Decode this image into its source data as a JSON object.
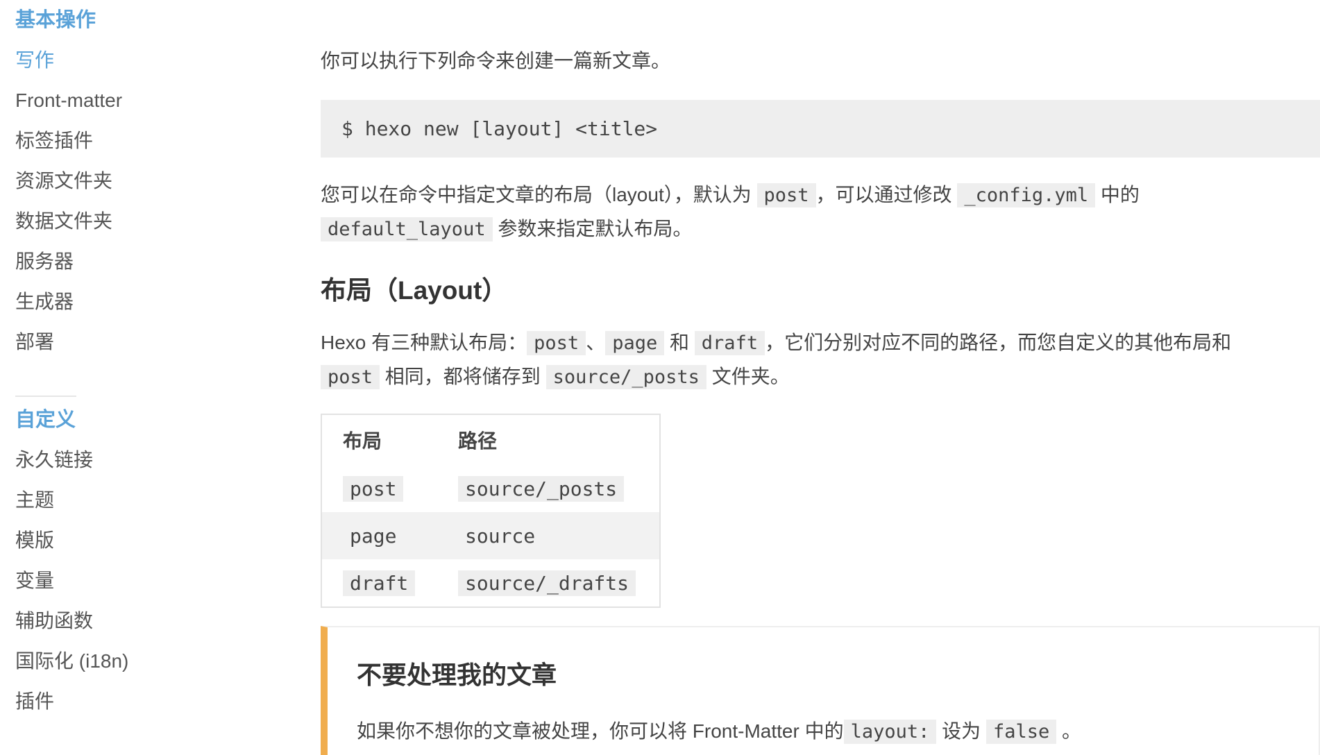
{
  "sidebar": {
    "group1_title": "基本操作",
    "group1_items": [
      "写作",
      "Front-matter",
      "标签插件",
      "资源文件夹",
      "数据文件夹",
      "服务器",
      "生成器",
      "部署"
    ],
    "group2_title": "自定义",
    "group2_items": [
      "永久链接",
      "主题",
      "模版",
      "变量",
      "辅助函数",
      "国际化 (i18n)",
      "插件"
    ]
  },
  "main": {
    "intro": "你可以执行下列命令来创建一篇新文章。",
    "command": "$ hexo new [layout] <title>",
    "layout_para": {
      "t1": "您可以在命令中指定文章的布局（layout），默认为 ",
      "c1": "post",
      "t2": "，可以通过修改 ",
      "c2": "_config.yml",
      "t3": " 中的 ",
      "c3": "default_layout",
      "t4": " 参数来指定默认布局。"
    },
    "heading": "布局（Layout）",
    "hexo_para": {
      "t1": "Hexo 有三种默认布局：",
      "c1": "post",
      "t2": "、",
      "c2": "page",
      "t3": " 和 ",
      "c3": "draft",
      "t4": "，它们分别对应不同的路径，而您自定义的其他布局和 ",
      "c4": "post",
      "t5": " 相同，都将储存到 ",
      "c5": "source/_posts",
      "t6": " 文件夹。"
    },
    "table": {
      "headers": [
        "布局",
        "路径"
      ],
      "rows": [
        [
          "post",
          "source/_posts"
        ],
        [
          "page",
          "source"
        ],
        [
          "draft",
          "source/_drafts"
        ]
      ]
    },
    "note": {
      "title": "不要处理我的文章",
      "t1": "如果你不想你的文章被处理，你可以将 Front-Matter 中的",
      "c1": "layout:",
      "t2": " 设为 ",
      "c2": "false",
      "t3": " 。"
    }
  },
  "colors": {
    "accent": "#5aa2d8",
    "note_border": "#f0ad4e",
    "code_bg": "#eeeeee"
  }
}
